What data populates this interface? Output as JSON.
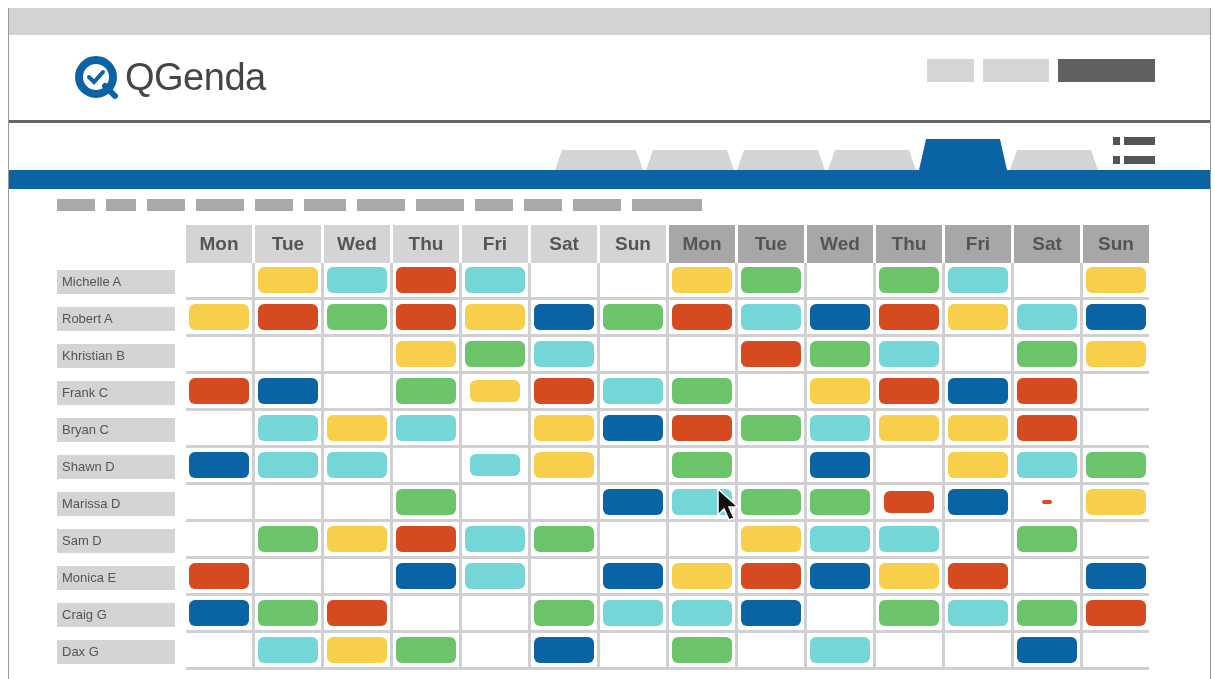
{
  "logo": {
    "text": "QGenda"
  },
  "tabs": [
    {
      "selected": false
    },
    {
      "selected": false
    },
    {
      "selected": false
    },
    {
      "selected": false
    },
    {
      "selected": true
    },
    {
      "selected": false
    }
  ],
  "days": [
    {
      "label": "Mon",
      "shaded": false
    },
    {
      "label": "Tue",
      "shaded": false
    },
    {
      "label": "Wed",
      "shaded": false
    },
    {
      "label": "Thu",
      "shaded": false
    },
    {
      "label": "Fri",
      "shaded": false
    },
    {
      "label": "Sat",
      "shaded": false
    },
    {
      "label": "Sun",
      "shaded": false
    },
    {
      "label": "Mon",
      "shaded": true
    },
    {
      "label": "Tue",
      "shaded": true
    },
    {
      "label": "Wed",
      "shaded": true
    },
    {
      "label": "Thu",
      "shaded": true
    },
    {
      "label": "Fri",
      "shaded": true
    },
    {
      "label": "Sat",
      "shaded": true
    },
    {
      "label": "Sun",
      "shaded": true
    }
  ],
  "rows": [
    {
      "name": "Michelle A",
      "shifts": [
        {
          "kind": "empty"
        },
        {
          "color": "#f8cf4a",
          "kind": "full"
        },
        {
          "color": "#74d6d6",
          "kind": "full"
        },
        {
          "color": "#d64a1f",
          "kind": "full"
        },
        {
          "color": "#74d6d6",
          "kind": "full"
        },
        {
          "kind": "empty"
        },
        {
          "kind": "empty"
        },
        {
          "color": "#f8cf4a",
          "kind": "full"
        },
        {
          "color": "#6cc46a",
          "kind": "full"
        },
        {
          "kind": "empty"
        },
        {
          "color": "#6cc46a",
          "kind": "full"
        },
        {
          "color": "#74d6d6",
          "kind": "full"
        },
        {
          "kind": "empty"
        },
        {
          "color": "#f8cf4a",
          "kind": "full"
        }
      ]
    },
    {
      "name": "Robert A",
      "shifts": [
        {
          "color": "#f8cf4a",
          "kind": "full"
        },
        {
          "color": "#d64a1f",
          "kind": "full"
        },
        {
          "color": "#6cc46a",
          "kind": "full"
        },
        {
          "color": "#d64a1f",
          "kind": "full"
        },
        {
          "color": "#f8cf4a",
          "kind": "full"
        },
        {
          "color": "#0a63a3",
          "kind": "full"
        },
        {
          "color": "#6cc46a",
          "kind": "full"
        },
        {
          "color": "#d64a1f",
          "kind": "full"
        },
        {
          "color": "#74d6d6",
          "kind": "full"
        },
        {
          "color": "#0a63a3",
          "kind": "full"
        },
        {
          "color": "#d64a1f",
          "kind": "full"
        },
        {
          "color": "#f8cf4a",
          "kind": "full"
        },
        {
          "color": "#74d6d6",
          "kind": "full"
        },
        {
          "color": "#0a63a3",
          "kind": "full"
        }
      ]
    },
    {
      "name": "Khristian B",
      "shifts": [
        {
          "kind": "empty"
        },
        {
          "kind": "empty"
        },
        {
          "kind": "empty"
        },
        {
          "color": "#f8cf4a",
          "kind": "full"
        },
        {
          "color": "#6cc46a",
          "kind": "full"
        },
        {
          "color": "#74d6d6",
          "kind": "full"
        },
        {
          "kind": "empty"
        },
        {
          "kind": "empty"
        },
        {
          "color": "#d64a1f",
          "kind": "full"
        },
        {
          "color": "#6cc46a",
          "kind": "full"
        },
        {
          "color": "#74d6d6",
          "kind": "full"
        },
        {
          "kind": "empty"
        },
        {
          "color": "#6cc46a",
          "kind": "full"
        },
        {
          "color": "#f8cf4a",
          "kind": "full"
        }
      ]
    },
    {
      "name": "Frank C",
      "shifts": [
        {
          "color": "#d64a1f",
          "kind": "full"
        },
        {
          "color": "#0a63a3",
          "kind": "full"
        },
        {
          "kind": "empty"
        },
        {
          "color": "#6cc46a",
          "kind": "full"
        },
        {
          "color": "#f8cf4a",
          "kind": "short"
        },
        {
          "color": "#d64a1f",
          "kind": "full"
        },
        {
          "color": "#74d6d6",
          "kind": "full"
        },
        {
          "color": "#6cc46a",
          "kind": "full"
        },
        {
          "kind": "empty"
        },
        {
          "color": "#f8cf4a",
          "kind": "full"
        },
        {
          "color": "#d64a1f",
          "kind": "full"
        },
        {
          "color": "#0a63a3",
          "kind": "full"
        },
        {
          "color": "#d64a1f",
          "kind": "full"
        },
        {
          "kind": "empty"
        }
      ]
    },
    {
      "name": "Bryan C",
      "shifts": [
        {
          "kind": "empty"
        },
        {
          "color": "#74d6d6",
          "kind": "full"
        },
        {
          "color": "#f8cf4a",
          "kind": "full"
        },
        {
          "color": "#74d6d6",
          "kind": "full"
        },
        {
          "kind": "empty"
        },
        {
          "color": "#f8cf4a",
          "kind": "full"
        },
        {
          "color": "#0a63a3",
          "kind": "full"
        },
        {
          "color": "#d64a1f",
          "kind": "full"
        },
        {
          "color": "#6cc46a",
          "kind": "full"
        },
        {
          "color": "#74d6d6",
          "kind": "full"
        },
        {
          "color": "#f8cf4a",
          "kind": "full"
        },
        {
          "color": "#f8cf4a",
          "kind": "full"
        },
        {
          "color": "#d64a1f",
          "kind": "full"
        },
        {
          "kind": "empty"
        }
      ]
    },
    {
      "name": "Shawn D",
      "shifts": [
        {
          "color": "#0a63a3",
          "kind": "full"
        },
        {
          "color": "#74d6d6",
          "kind": "full"
        },
        {
          "color": "#74d6d6",
          "kind": "full"
        },
        {
          "kind": "empty"
        },
        {
          "color": "#74d6d6",
          "kind": "short"
        },
        {
          "color": "#f8cf4a",
          "kind": "full"
        },
        {
          "kind": "empty"
        },
        {
          "color": "#6cc46a",
          "kind": "full"
        },
        {
          "kind": "empty"
        },
        {
          "color": "#0a63a3",
          "kind": "full"
        },
        {
          "kind": "empty"
        },
        {
          "color": "#f8cf4a",
          "kind": "full"
        },
        {
          "color": "#74d6d6",
          "kind": "full"
        },
        {
          "color": "#6cc46a",
          "kind": "full"
        }
      ]
    },
    {
      "name": "Marissa D",
      "shifts": [
        {
          "kind": "empty"
        },
        {
          "kind": "empty"
        },
        {
          "kind": "empty"
        },
        {
          "color": "#6cc46a",
          "kind": "full"
        },
        {
          "kind": "empty"
        },
        {
          "kind": "empty"
        },
        {
          "color": "#0a63a3",
          "kind": "full"
        },
        {
          "color": "#74d6d6",
          "kind": "full"
        },
        {
          "color": "#6cc46a",
          "kind": "full"
        },
        {
          "color": "#6cc46a",
          "kind": "full"
        },
        {
          "color": "#d64a1f",
          "kind": "short"
        },
        {
          "color": "#0a63a3",
          "kind": "full"
        },
        {
          "color": "#d64a1f",
          "kind": "dash"
        },
        {
          "color": "#f8cf4a",
          "kind": "full"
        }
      ]
    },
    {
      "name": "Sam D",
      "shifts": [
        {
          "kind": "empty"
        },
        {
          "color": "#6cc46a",
          "kind": "full"
        },
        {
          "color": "#f8cf4a",
          "kind": "full"
        },
        {
          "color": "#d64a1f",
          "kind": "full"
        },
        {
          "color": "#74d6d6",
          "kind": "full"
        },
        {
          "color": "#6cc46a",
          "kind": "full"
        },
        {
          "kind": "empty"
        },
        {
          "kind": "empty"
        },
        {
          "color": "#f8cf4a",
          "kind": "full"
        },
        {
          "color": "#74d6d6",
          "kind": "full"
        },
        {
          "color": "#74d6d6",
          "kind": "full"
        },
        {
          "kind": "empty"
        },
        {
          "color": "#6cc46a",
          "kind": "full"
        },
        {
          "kind": "empty"
        }
      ]
    },
    {
      "name": "Monica E",
      "shifts": [
        {
          "color": "#d64a1f",
          "kind": "full"
        },
        {
          "kind": "empty"
        },
        {
          "kind": "empty"
        },
        {
          "color": "#0a63a3",
          "kind": "full"
        },
        {
          "color": "#74d6d6",
          "kind": "full"
        },
        {
          "kind": "empty"
        },
        {
          "color": "#0a63a3",
          "kind": "full"
        },
        {
          "color": "#f8cf4a",
          "kind": "full"
        },
        {
          "color": "#d64a1f",
          "kind": "full"
        },
        {
          "color": "#0a63a3",
          "kind": "full"
        },
        {
          "color": "#f8cf4a",
          "kind": "full"
        },
        {
          "color": "#d64a1f",
          "kind": "full"
        },
        {
          "kind": "empty"
        },
        {
          "color": "#0a63a3",
          "kind": "full"
        }
      ]
    },
    {
      "name": "Craig G",
      "shifts": [
        {
          "color": "#0a63a3",
          "kind": "full"
        },
        {
          "color": "#6cc46a",
          "kind": "full"
        },
        {
          "color": "#d64a1f",
          "kind": "full"
        },
        {
          "kind": "empty"
        },
        {
          "kind": "empty"
        },
        {
          "color": "#6cc46a",
          "kind": "full"
        },
        {
          "color": "#74d6d6",
          "kind": "full"
        },
        {
          "color": "#74d6d6",
          "kind": "full"
        },
        {
          "color": "#0a63a3",
          "kind": "full"
        },
        {
          "kind": "empty"
        },
        {
          "color": "#6cc46a",
          "kind": "full"
        },
        {
          "color": "#74d6d6",
          "kind": "full"
        },
        {
          "color": "#6cc46a",
          "kind": "full"
        },
        {
          "color": "#d64a1f",
          "kind": "full"
        }
      ]
    },
    {
      "name": "Dax G",
      "shifts": [
        {
          "kind": "empty"
        },
        {
          "color": "#74d6d6",
          "kind": "full"
        },
        {
          "color": "#f8cf4a",
          "kind": "full"
        },
        {
          "color": "#6cc46a",
          "kind": "full"
        },
        {
          "kind": "empty"
        },
        {
          "color": "#0a63a3",
          "kind": "full"
        },
        {
          "kind": "empty"
        },
        {
          "color": "#6cc46a",
          "kind": "full"
        },
        {
          "kind": "empty"
        },
        {
          "color": "#74d6d6",
          "kind": "full"
        },
        {
          "kind": "empty"
        },
        {
          "kind": "empty"
        },
        {
          "color": "#0a63a3",
          "kind": "full"
        },
        {
          "kind": "empty"
        }
      ]
    }
  ]
}
